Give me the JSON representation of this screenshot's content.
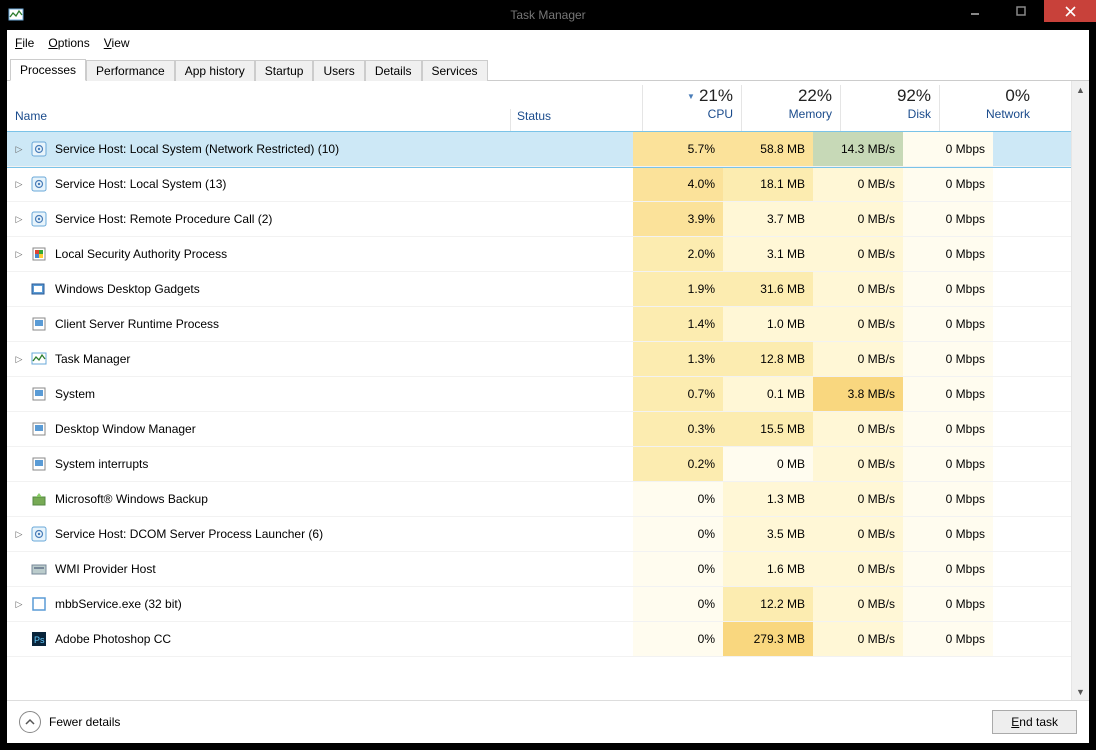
{
  "window": {
    "title": "Task Manager"
  },
  "menu": {
    "file": "File",
    "options": "Options",
    "view": "View"
  },
  "tabs": [
    "Processes",
    "Performance",
    "App history",
    "Startup",
    "Users",
    "Details",
    "Services"
  ],
  "active_tab": 0,
  "columns": {
    "name": "Name",
    "status": "Status",
    "cpu_pct": "21%",
    "cpu_lbl": "CPU",
    "mem_pct": "22%",
    "mem_lbl": "Memory",
    "disk_pct": "92%",
    "disk_lbl": "Disk",
    "net_pct": "0%",
    "net_lbl": "Network",
    "sorted": "cpu"
  },
  "processes": [
    {
      "exp": true,
      "icon": "gear",
      "name": "Service Host: Local System (Network Restricted) (10)",
      "cpu": "5.7%",
      "cpu_h": 3,
      "mem": "58.8 MB",
      "mem_h": 3,
      "disk": "14.3 MB/s",
      "disk_h": "sel",
      "net": "0 Mbps",
      "net_h": 0,
      "selected": true
    },
    {
      "exp": true,
      "icon": "gear",
      "name": "Service Host: Local System (13)",
      "cpu": "4.0%",
      "cpu_h": 3,
      "mem": "18.1 MB",
      "mem_h": 2,
      "disk": "0 MB/s",
      "disk_h": 1,
      "net": "0 Mbps",
      "net_h": 0
    },
    {
      "exp": true,
      "icon": "gear",
      "name": "Service Host: Remote Procedure Call (2)",
      "cpu": "3.9%",
      "cpu_h": 3,
      "mem": "3.7 MB",
      "mem_h": 1,
      "disk": "0 MB/s",
      "disk_h": 1,
      "net": "0 Mbps",
      "net_h": 0
    },
    {
      "exp": true,
      "icon": "shield",
      "name": "Local Security Authority Process",
      "cpu": "2.0%",
      "cpu_h": 2,
      "mem": "3.1 MB",
      "mem_h": 1,
      "disk": "0 MB/s",
      "disk_h": 1,
      "net": "0 Mbps",
      "net_h": 0
    },
    {
      "exp": false,
      "icon": "gadget",
      "name": "Windows Desktop Gadgets",
      "cpu": "1.9%",
      "cpu_h": 2,
      "mem": "31.6 MB",
      "mem_h": 2,
      "disk": "0 MB/s",
      "disk_h": 1,
      "net": "0 Mbps",
      "net_h": 0
    },
    {
      "exp": false,
      "icon": "app",
      "name": "Client Server Runtime Process",
      "cpu": "1.4%",
      "cpu_h": 2,
      "mem": "1.0 MB",
      "mem_h": 1,
      "disk": "0 MB/s",
      "disk_h": 1,
      "net": "0 Mbps",
      "net_h": 0
    },
    {
      "exp": true,
      "icon": "taskmgr",
      "name": "Task Manager",
      "cpu": "1.3%",
      "cpu_h": 2,
      "mem": "12.8 MB",
      "mem_h": 2,
      "disk": "0 MB/s",
      "disk_h": 1,
      "net": "0 Mbps",
      "net_h": 0
    },
    {
      "exp": false,
      "icon": "app",
      "name": "System",
      "cpu": "0.7%",
      "cpu_h": 2,
      "mem": "0.1 MB",
      "mem_h": 1,
      "disk": "3.8 MB/s",
      "disk_h": 4,
      "net": "0 Mbps",
      "net_h": 0
    },
    {
      "exp": false,
      "icon": "app",
      "name": "Desktop Window Manager",
      "cpu": "0.3%",
      "cpu_h": 2,
      "mem": "15.5 MB",
      "mem_h": 2,
      "disk": "0 MB/s",
      "disk_h": 1,
      "net": "0 Mbps",
      "net_h": 0
    },
    {
      "exp": false,
      "icon": "app",
      "name": "System interrupts",
      "cpu": "0.2%",
      "cpu_h": 2,
      "mem": "0 MB",
      "mem_h": 0,
      "disk": "0 MB/s",
      "disk_h": 1,
      "net": "0 Mbps",
      "net_h": 0
    },
    {
      "exp": false,
      "icon": "backup",
      "name": "Microsoft® Windows Backup",
      "cpu": "0%",
      "cpu_h": 0,
      "mem": "1.3 MB",
      "mem_h": 1,
      "disk": "0 MB/s",
      "disk_h": 1,
      "net": "0 Mbps",
      "net_h": 0
    },
    {
      "exp": true,
      "icon": "gear",
      "name": "Service Host: DCOM Server Process Launcher (6)",
      "cpu": "0%",
      "cpu_h": 0,
      "mem": "3.5 MB",
      "mem_h": 1,
      "disk": "0 MB/s",
      "disk_h": 1,
      "net": "0 Mbps",
      "net_h": 0
    },
    {
      "exp": false,
      "icon": "wmi",
      "name": "WMI Provider Host",
      "cpu": "0%",
      "cpu_h": 0,
      "mem": "1.6 MB",
      "mem_h": 1,
      "disk": "0 MB/s",
      "disk_h": 1,
      "net": "0 Mbps",
      "net_h": 0
    },
    {
      "exp": true,
      "icon": "blank",
      "name": "mbbService.exe (32 bit)",
      "cpu": "0%",
      "cpu_h": 0,
      "mem": "12.2 MB",
      "mem_h": 2,
      "disk": "0 MB/s",
      "disk_h": 1,
      "net": "0 Mbps",
      "net_h": 0
    },
    {
      "exp": false,
      "icon": "ps",
      "name": "Adobe Photoshop CC",
      "cpu": "0%",
      "cpu_h": 0,
      "mem": "279.3 MB",
      "mem_h": 4,
      "disk": "0 MB/s",
      "disk_h": 1,
      "net": "0 Mbps",
      "net_h": 0
    }
  ],
  "footer": {
    "fewer": "Fewer details",
    "end_task": "End task"
  }
}
